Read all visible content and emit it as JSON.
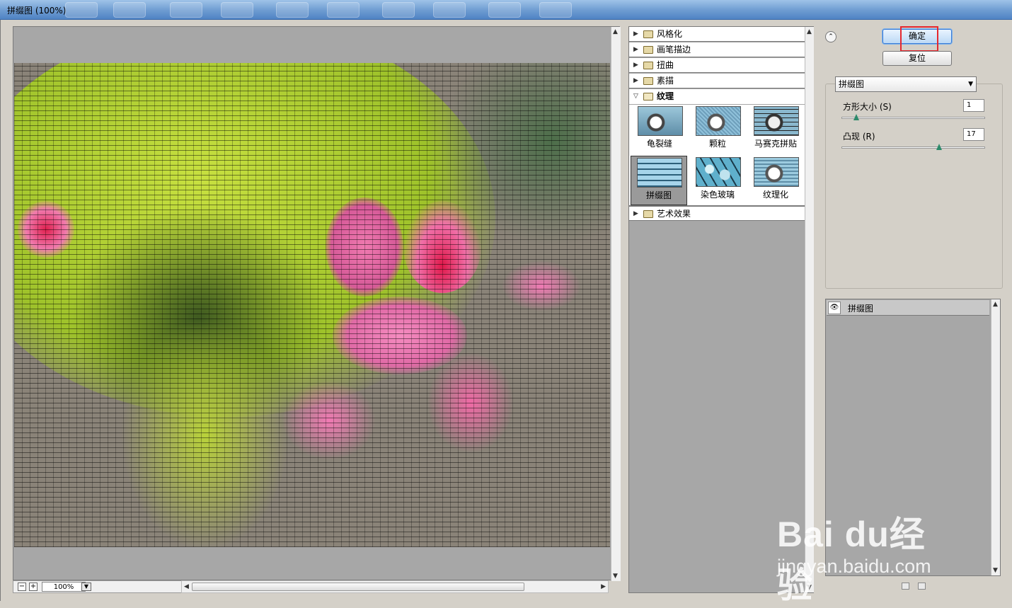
{
  "window": {
    "title": "拼缀图 (100%)"
  },
  "preview": {
    "zoom": "100%"
  },
  "gallery": {
    "categories": [
      {
        "label": "风格化",
        "expanded": false
      },
      {
        "label": "画笔描边",
        "expanded": false
      },
      {
        "label": "扭曲",
        "expanded": false
      },
      {
        "label": "素描",
        "expanded": false
      },
      {
        "label": "纹理",
        "expanded": true
      },
      {
        "label": "艺术效果",
        "expanded": false
      }
    ],
    "texture_filters": [
      {
        "label": "龟裂缝"
      },
      {
        "label": "颗粒"
      },
      {
        "label": "马赛克拼贴"
      },
      {
        "label": "拼缀图",
        "selected": true
      },
      {
        "label": "染色玻璃"
      },
      {
        "label": "纹理化"
      }
    ]
  },
  "buttons": {
    "ok": "确定",
    "reset": "复位"
  },
  "settings": {
    "filter_select": "拼缀图",
    "params": [
      {
        "label": "方形大小 (S)",
        "value": "1",
        "level": 0.1
      },
      {
        "label": "凸现 (R)",
        "value": "17",
        "level": 0.68
      }
    ]
  },
  "layers": {
    "items": [
      {
        "label": "拼缀图",
        "visible": true
      }
    ]
  },
  "watermark": {
    "brand": "Bai du经验",
    "url": "jingyan.baidu.com"
  },
  "colors": {
    "highlight": "#e5282f",
    "selection_accent": "#3a7bd5"
  }
}
